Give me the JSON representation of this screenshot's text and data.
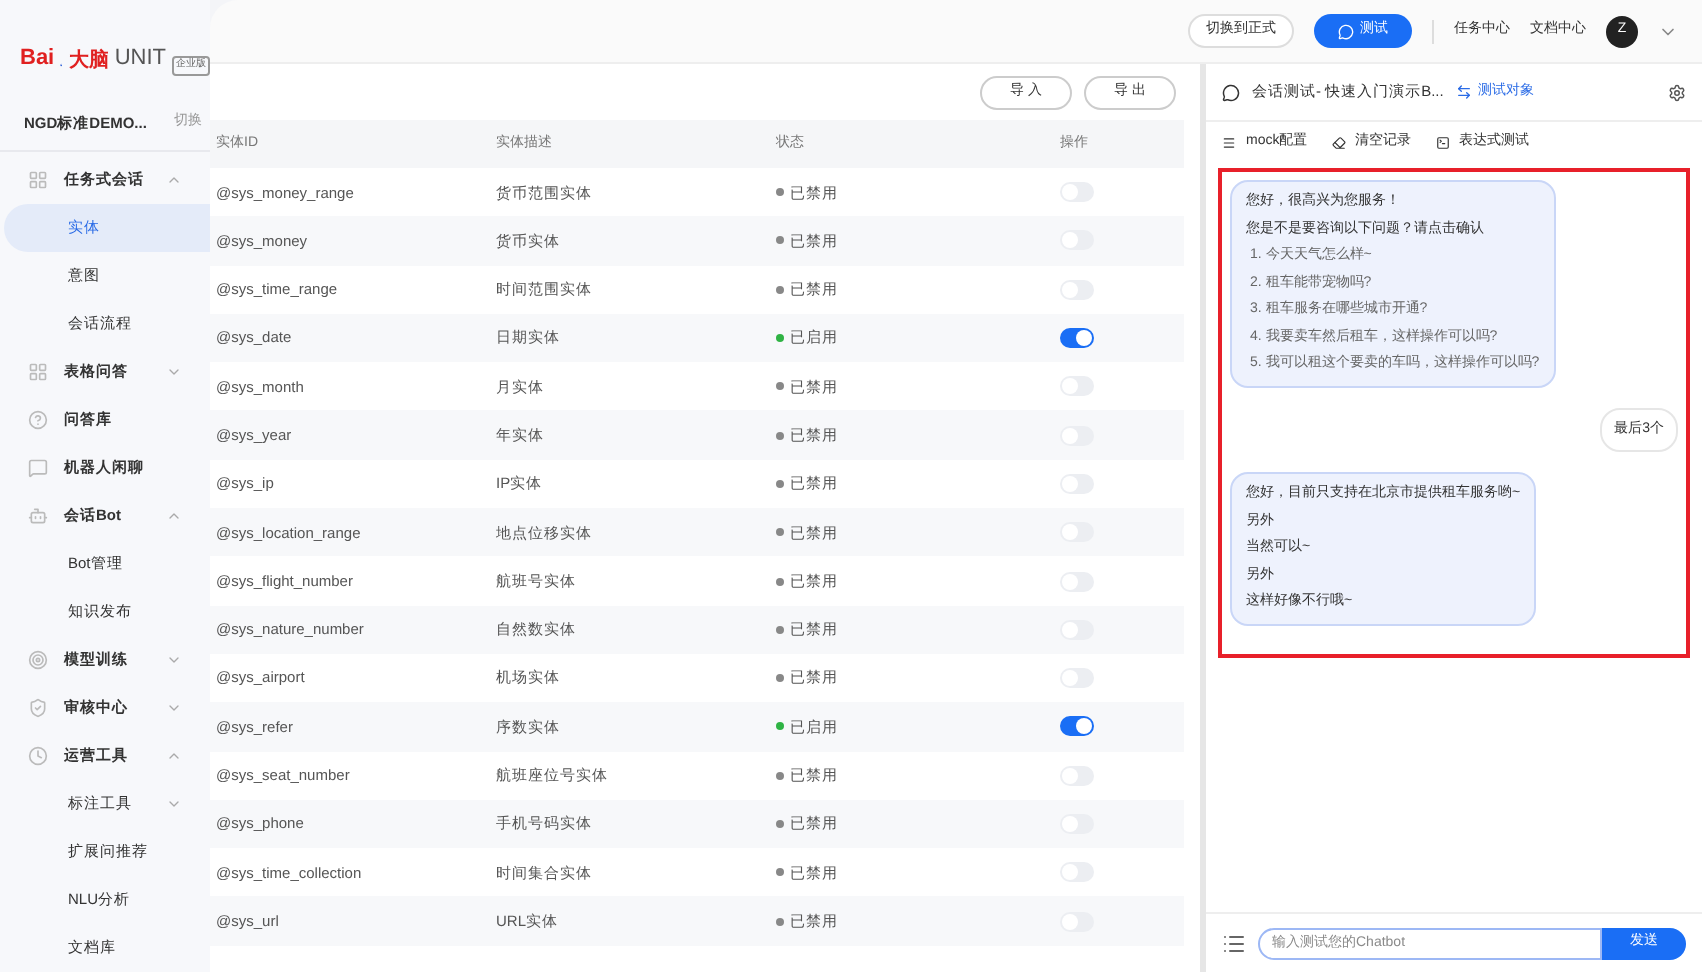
{
  "brand": {
    "logo_left": "Bai",
    "logo_right": "大脑",
    "product": "UNIT",
    "edition": "企业版"
  },
  "project": {
    "name": "NGD标准DEMO...",
    "switch": "切换"
  },
  "sidebar": {
    "items": [
      {
        "label": "任务式会话",
        "expanded": true,
        "children": [
          {
            "label": "实体",
            "selected": true
          },
          {
            "label": "意图",
            "selected": false
          },
          {
            "label": "会话流程",
            "selected": false
          }
        ]
      },
      {
        "label": "表格问答",
        "expanded": false
      },
      {
        "label": "问答库"
      },
      {
        "label": "机器人闲聊"
      },
      {
        "label": "会话Bot",
        "expanded": true,
        "children": [
          {
            "label": "Bot管理",
            "selected": false
          },
          {
            "label": "知识发布",
            "selected": false
          }
        ]
      },
      {
        "label": "模型训练",
        "expanded": false
      },
      {
        "label": "审核中心",
        "expanded": false
      },
      {
        "label": "运营工具",
        "expanded": true,
        "children": [
          {
            "label": "标注工具",
            "selected": false,
            "expanded": false
          },
          {
            "label": "扩展问推荐",
            "selected": false
          },
          {
            "label": "NLU分析",
            "selected": false
          },
          {
            "label": "文档库",
            "selected": false
          }
        ]
      }
    ]
  },
  "topbar": {
    "switch_button": "切换到正式",
    "test_button": "测试",
    "links": [
      "任务中心",
      "文档中心"
    ],
    "avatar": "Z"
  },
  "toolbar": {
    "buttons": [
      "导 入",
      "导 出"
    ]
  },
  "table": {
    "columns": [
      "实体ID",
      "实体描述",
      "状态",
      "操作"
    ],
    "rows": [
      {
        "id": "@sys_money_range",
        "desc": "货币范围实体",
        "status": "已禁用",
        "on": false
      },
      {
        "id": "@sys_money",
        "desc": "货币实体",
        "status": "已禁用",
        "on": false
      },
      {
        "id": "@sys_time_range",
        "desc": "时间范围实体",
        "status": "已禁用",
        "on": false
      },
      {
        "id": "@sys_date",
        "desc": "日期实体",
        "status": "已启用",
        "on": true
      },
      {
        "id": "@sys_month",
        "desc": "月实体",
        "status": "已禁用",
        "on": false
      },
      {
        "id": "@sys_year",
        "desc": "年实体",
        "status": "已禁用",
        "on": false
      },
      {
        "id": "@sys_ip",
        "desc": "IP实体",
        "status": "已禁用",
        "on": false
      },
      {
        "id": "@sys_location_range",
        "desc": "地点位移实体",
        "status": "已禁用",
        "on": false
      },
      {
        "id": "@sys_flight_number",
        "desc": "航班号实体",
        "status": "已禁用",
        "on": false
      },
      {
        "id": "@sys_nature_number",
        "desc": "自然数实体",
        "status": "已禁用",
        "on": false
      },
      {
        "id": "@sys_airport",
        "desc": "机场实体",
        "status": "已禁用",
        "on": false
      },
      {
        "id": "@sys_refer",
        "desc": "序数实体",
        "status": "已启用",
        "on": true
      },
      {
        "id": "@sys_seat_number",
        "desc": "航班座位号实体",
        "status": "已禁用",
        "on": false
      },
      {
        "id": "@sys_phone",
        "desc": "手机号码实体",
        "status": "已禁用",
        "on": false
      },
      {
        "id": "@sys_time_collection",
        "desc": "时间集合实体",
        "status": "已禁用",
        "on": false
      },
      {
        "id": "@sys_url",
        "desc": "URL实体",
        "status": "已禁用",
        "on": false
      }
    ]
  },
  "chat": {
    "title": "会话测试- 快速入门演示B...",
    "target": "测试对象",
    "tools": [
      "mock配置",
      "清空记录",
      "表达式测试"
    ],
    "messages": [
      {
        "kind": "bot",
        "lines": [
          "您好，很高兴为您服务！",
          "您是不是要咨询以下问题？请点击确认"
        ],
        "options": [
          "1. 今天天气怎么样~",
          "2. 租车能带宠物吗?",
          "3. 租车服务在哪些城市开通?",
          "4. 我要卖车然后租车，这样操作可以吗?",
          "5. 我可以租这个要卖的车吗，这样操作可以吗?"
        ]
      },
      {
        "kind": "user",
        "lines": [
          "最后3个"
        ]
      },
      {
        "kind": "bot",
        "lines": [
          "您好，目前只支持在北京市提供租车服务哟~",
          "另外",
          "当然可以~",
          "另外",
          "这样好像不行哦~"
        ]
      }
    ],
    "input": {
      "placeholder": "输入测试您的Chatbot",
      "send": "发送"
    }
  }
}
